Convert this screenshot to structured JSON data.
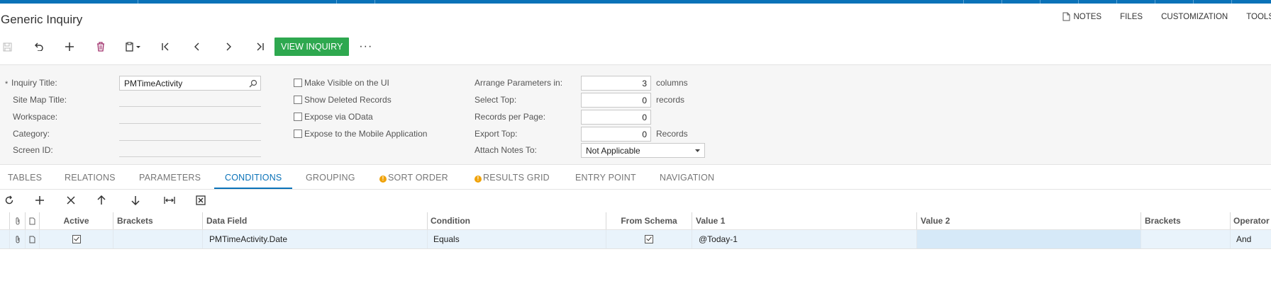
{
  "page_title": "Generic Inquiry",
  "header_actions": {
    "notes": "NOTES",
    "files": "FILES",
    "customization": "CUSTOMIZATION",
    "tools": "TOOLS"
  },
  "toolbar": {
    "view_inquiry": "VIEW INQUIRY",
    "more": "···"
  },
  "form": {
    "required_mark": "*",
    "inquiry_title_label": "Inquiry Title:",
    "inquiry_title_value": "PMTimeActivity",
    "site_map_title_label": "Site Map Title:",
    "workspace_label": "Workspace:",
    "category_label": "Category:",
    "screen_id_label": "Screen ID:",
    "make_visible_label": "Make Visible on the UI",
    "show_deleted_label": "Show Deleted Records",
    "expose_odata_label": "Expose via OData",
    "expose_mobile_label": "Expose to the Mobile Application",
    "arrange_params_label": "Arrange Parameters in:",
    "arrange_params_value": "3",
    "arrange_params_unit": "columns",
    "select_top_label": "Select Top:",
    "select_top_value": "0",
    "select_top_unit": "records",
    "records_per_page_label": "Records per Page:",
    "records_per_page_value": "0",
    "export_top_label": "Export Top:",
    "export_top_value": "0",
    "export_top_unit": "Records",
    "attach_notes_label": "Attach Notes To:",
    "attach_notes_value": "Not Applicable"
  },
  "tabs": [
    {
      "label": "TABLES"
    },
    {
      "label": "RELATIONS"
    },
    {
      "label": "PARAMETERS"
    },
    {
      "label": "CONDITIONS"
    },
    {
      "label": "GROUPING"
    },
    {
      "label": "SORT ORDER"
    },
    {
      "label": "RESULTS GRID"
    },
    {
      "label": "ENTRY POINT"
    },
    {
      "label": "NAVIGATION"
    }
  ],
  "active_tab": "CONDITIONS",
  "grid": {
    "columns": [
      "Active",
      "Brackets",
      "Data Field",
      "Condition",
      "From Schema",
      "Value 1",
      "Value 2",
      "Brackets",
      "Operator"
    ],
    "rows": [
      {
        "active": true,
        "brackets": "",
        "data_field": "PMTimeActivity.Date",
        "condition": "Equals",
        "from_schema": true,
        "value1": "@Today-1",
        "value2": "",
        "brackets2": "",
        "operator": "And"
      }
    ]
  },
  "colors": {
    "accent": "#0a72b8",
    "primary_button": "#2ea84f",
    "warning": "#f0a30a",
    "selected_row": "#e9f3fb"
  }
}
